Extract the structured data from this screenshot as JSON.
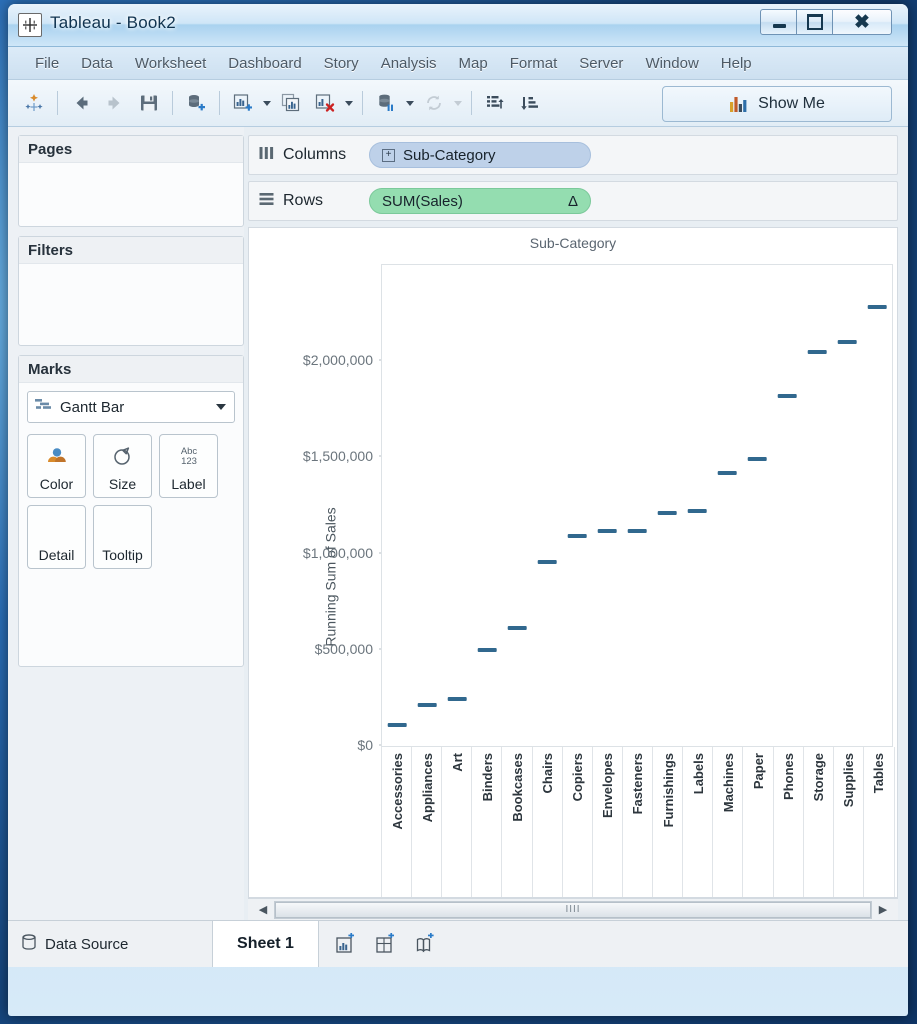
{
  "window": {
    "title": "Tableau - Book2",
    "app_icon": "tableau-icon",
    "controls": {
      "minimize": "minimize-icon",
      "maximize": "maximize-icon",
      "close": "close-icon"
    }
  },
  "menubar": {
    "items": [
      "File",
      "Data",
      "Worksheet",
      "Dashboard",
      "Story",
      "Analysis",
      "Map",
      "Format",
      "Server",
      "Window",
      "Help"
    ]
  },
  "toolbar": {
    "show_me_label": "Show Me",
    "buttons": [
      "tableau-sparkle-icon",
      "back-arrow-icon",
      "forward-arrow-icon",
      "save-icon",
      "new-data-source-icon",
      "new-worksheet-icon",
      "duplicate-sheet-icon",
      "clear-sheet-icon",
      "pause-updates-icon",
      "refresh-icon",
      "swap-rows-columns-icon",
      "sort-descending-icon"
    ]
  },
  "sidebar": {
    "pages": {
      "title": "Pages"
    },
    "filters": {
      "title": "Filters"
    },
    "marks": {
      "title": "Marks",
      "mark_type": "Gantt Bar",
      "mark_type_icon": "gantt-bar-icon",
      "buttons": [
        {
          "label": "Color",
          "icon": "color-palette-icon"
        },
        {
          "label": "Size",
          "icon": "size-icon"
        },
        {
          "label": "Label",
          "icon": "abc123-icon"
        },
        {
          "label": "Detail",
          "icon": "detail-icon"
        },
        {
          "label": "Tooltip",
          "icon": "tooltip-icon"
        }
      ]
    }
  },
  "shelves": {
    "columns": {
      "label": "Columns",
      "icon": "columns-icon",
      "pill": "Sub-Category",
      "pill_color": "#bed1e9",
      "expand_glyph": "+"
    },
    "rows": {
      "label": "Rows",
      "icon": "rows-icon",
      "pill": "SUM(Sales)",
      "pill_color": "#94ddb0",
      "delta_glyph": "Δ"
    }
  },
  "scrollbar": {
    "left_arrow": "◀",
    "right_arrow": "▶",
    "grip": "IIII"
  },
  "statusbar": {
    "data_source_label": "Data Source",
    "data_source_icon": "database-icon",
    "sheet_tab": "Sheet 1",
    "new_tabs": [
      {
        "icon": "new-worksheet-tab-icon"
      },
      {
        "icon": "new-dashboard-tab-icon"
      },
      {
        "icon": "new-story-tab-icon"
      }
    ]
  },
  "chart_data": {
    "type": "bar",
    "mark_style": "gantt-bar",
    "title": "Sub-Category",
    "xlabel": "",
    "ylabel": "Running Sum of Sales",
    "ylim": [
      0,
      2500000
    ],
    "ytick_labels": [
      "$0",
      "$500,000",
      "$1,000,000",
      "$1,500,000",
      "$2,000,000"
    ],
    "ytick_values": [
      0,
      500000,
      1000000,
      1500000,
      2000000
    ],
    "grid": false,
    "legend": "none",
    "mark_color": "#31688e",
    "categories": [
      "Accessories",
      "Appliances",
      "Art",
      "Binders",
      "Bookcases",
      "Chairs",
      "Copiers",
      "Envelopes",
      "Fasteners",
      "Furnishings",
      "Labels",
      "Machines",
      "Paper",
      "Phones",
      "Storage",
      "Supplies",
      "Tables"
    ],
    "values": [
      110000,
      215000,
      245000,
      500000,
      615000,
      955000,
      1090000,
      1115000,
      1115000,
      1210000,
      1220000,
      1420000,
      1490000,
      1820000,
      2050000,
      2100000,
      2280000
    ],
    "series": [
      {
        "name": "Running Sum of Sales",
        "values": [
          110000,
          215000,
          245000,
          500000,
          615000,
          955000,
          1090000,
          1115000,
          1115000,
          1210000,
          1220000,
          1420000,
          1490000,
          1820000,
          2050000,
          2100000,
          2280000
        ]
      }
    ]
  }
}
